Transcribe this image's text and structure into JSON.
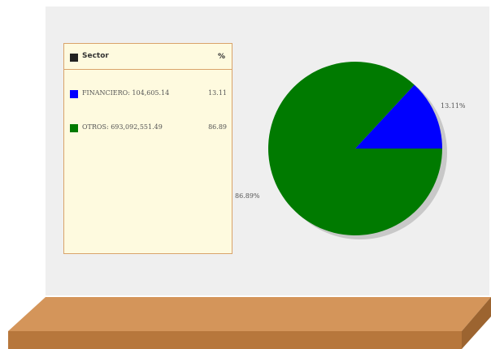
{
  "legend": {
    "header_label": "Sector",
    "header_pct": "%"
  },
  "chart_data": {
    "type": "pie",
    "categories": [
      "FINANCIERO",
      "OTROS"
    ],
    "values": [
      13.11,
      86.89
    ],
    "legend_labels": [
      "FINANCIERO: 104,605.14",
      "OTROS: 693,092,551.49"
    ],
    "legend_pcts": [
      "13.11",
      "86.89"
    ],
    "slice_labels": [
      "13.11%",
      "86.89%"
    ],
    "colors": [
      "#0000ff",
      "#007a00"
    ],
    "legend_placement": "left"
  },
  "colors": {
    "wall": "#efefef",
    "legend_bg": "#fefadf",
    "legend_border": "#d9a36a",
    "shelf_top": "#d4955a",
    "shelf_front": "#b7773c",
    "shelf_side": "#9c6430"
  }
}
